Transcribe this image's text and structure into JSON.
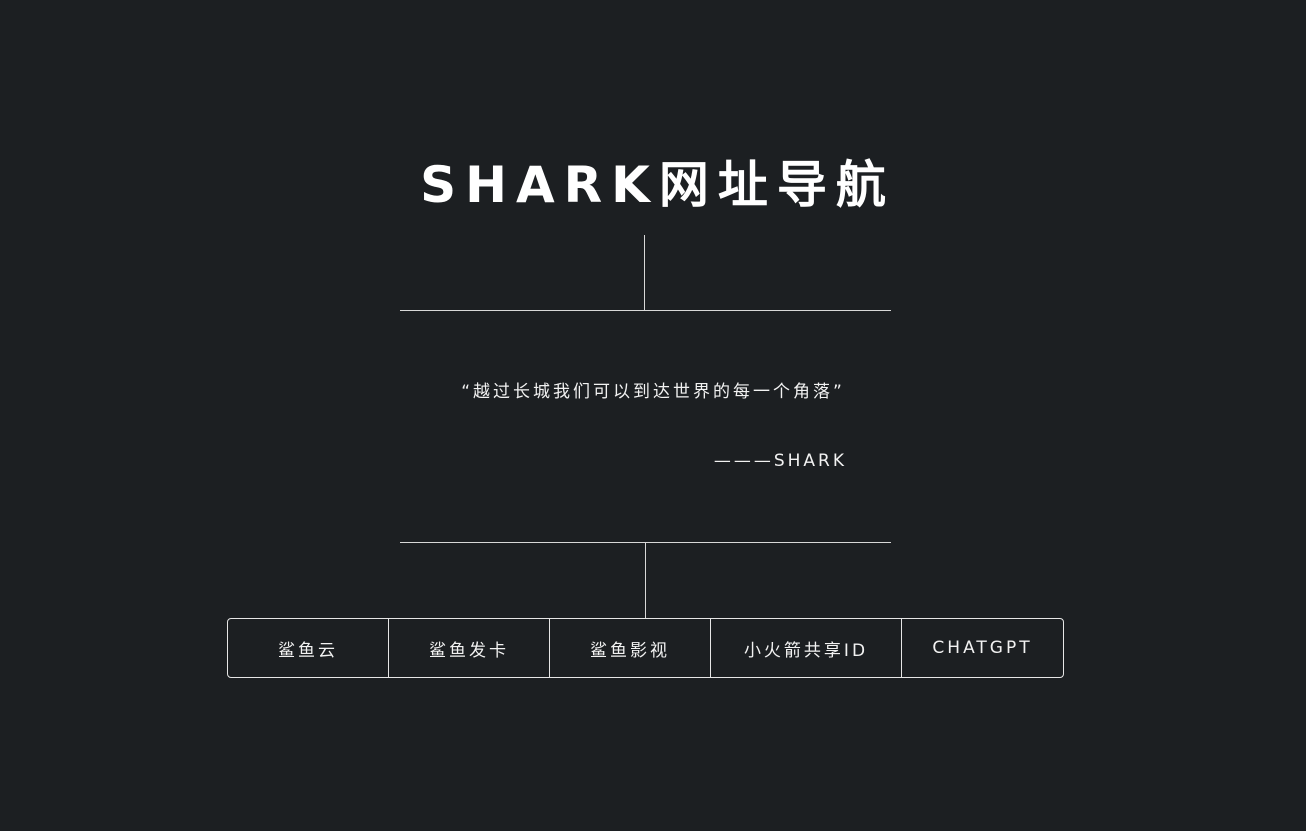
{
  "header": {
    "title": "SHARK网址导航"
  },
  "quote": {
    "text": "“越过长城我们可以到达世界的每一个角落”",
    "author": "———SHARK"
  },
  "nav": {
    "items": [
      {
        "label": "鲨鱼云"
      },
      {
        "label": "鲨鱼发卡"
      },
      {
        "label": "鲨鱼影视"
      },
      {
        "label": "小火箭共享ID"
      },
      {
        "label": "CHATGPT"
      }
    ]
  }
}
